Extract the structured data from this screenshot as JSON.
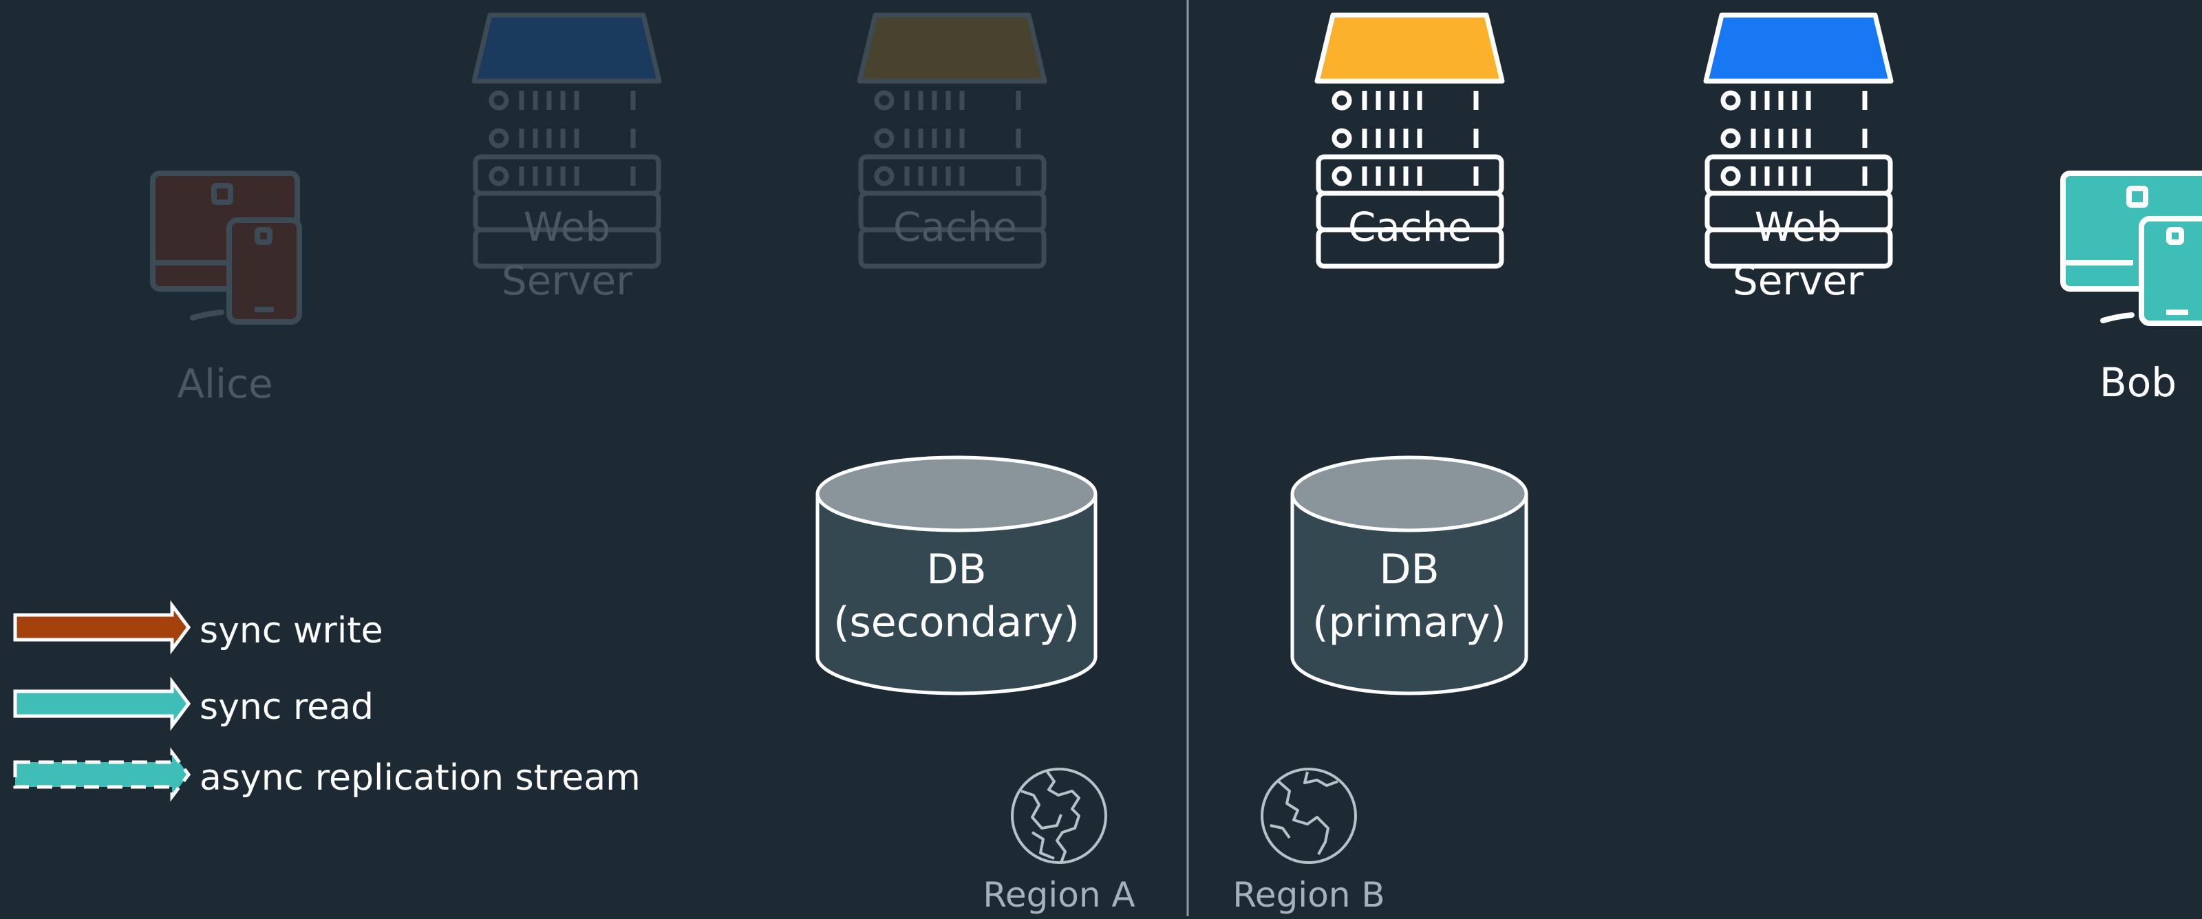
{
  "colors": {
    "background": "#1e2a33",
    "divider": "#8d99a3",
    "white": "#ffffff",
    "dim": "#3d4b56",
    "dim_text": "#4a5863",
    "cache_yellow": "#fbb12b",
    "web_blue": "#1877f2",
    "bob_teal": "#3fbdb7",
    "alice_brown": "#3a2b2a",
    "db_fill": "#344852",
    "db_top": "#8a949b",
    "sync_write": "#a5410d",
    "sync_read": "#3fbdb7",
    "region_text": "#a6b1b9",
    "globe_stroke": "#b7c1c8"
  },
  "region_a": {
    "label": "Region A",
    "client": "Alice",
    "web_server": [
      "Web",
      "Server"
    ],
    "cache": "Cache",
    "db": [
      "DB",
      "(secondary)"
    ]
  },
  "region_b": {
    "label": "Region B",
    "client": "Bob",
    "web_server": [
      "Web",
      "Server"
    ],
    "cache": "Cache",
    "db": [
      "DB",
      "(primary)"
    ]
  },
  "legend": [
    {
      "label": "sync write",
      "style": "solid",
      "color": "#a5410d"
    },
    {
      "label": "sync read",
      "style": "solid",
      "color": "#3fbdb7"
    },
    {
      "label": "async replication stream",
      "style": "dashed",
      "color": "#3fbdb7"
    }
  ],
  "icons": {
    "server": "server-rack-icon",
    "device": "desktop-phone-icon",
    "database": "database-icon",
    "globe": "globe-icon"
  }
}
